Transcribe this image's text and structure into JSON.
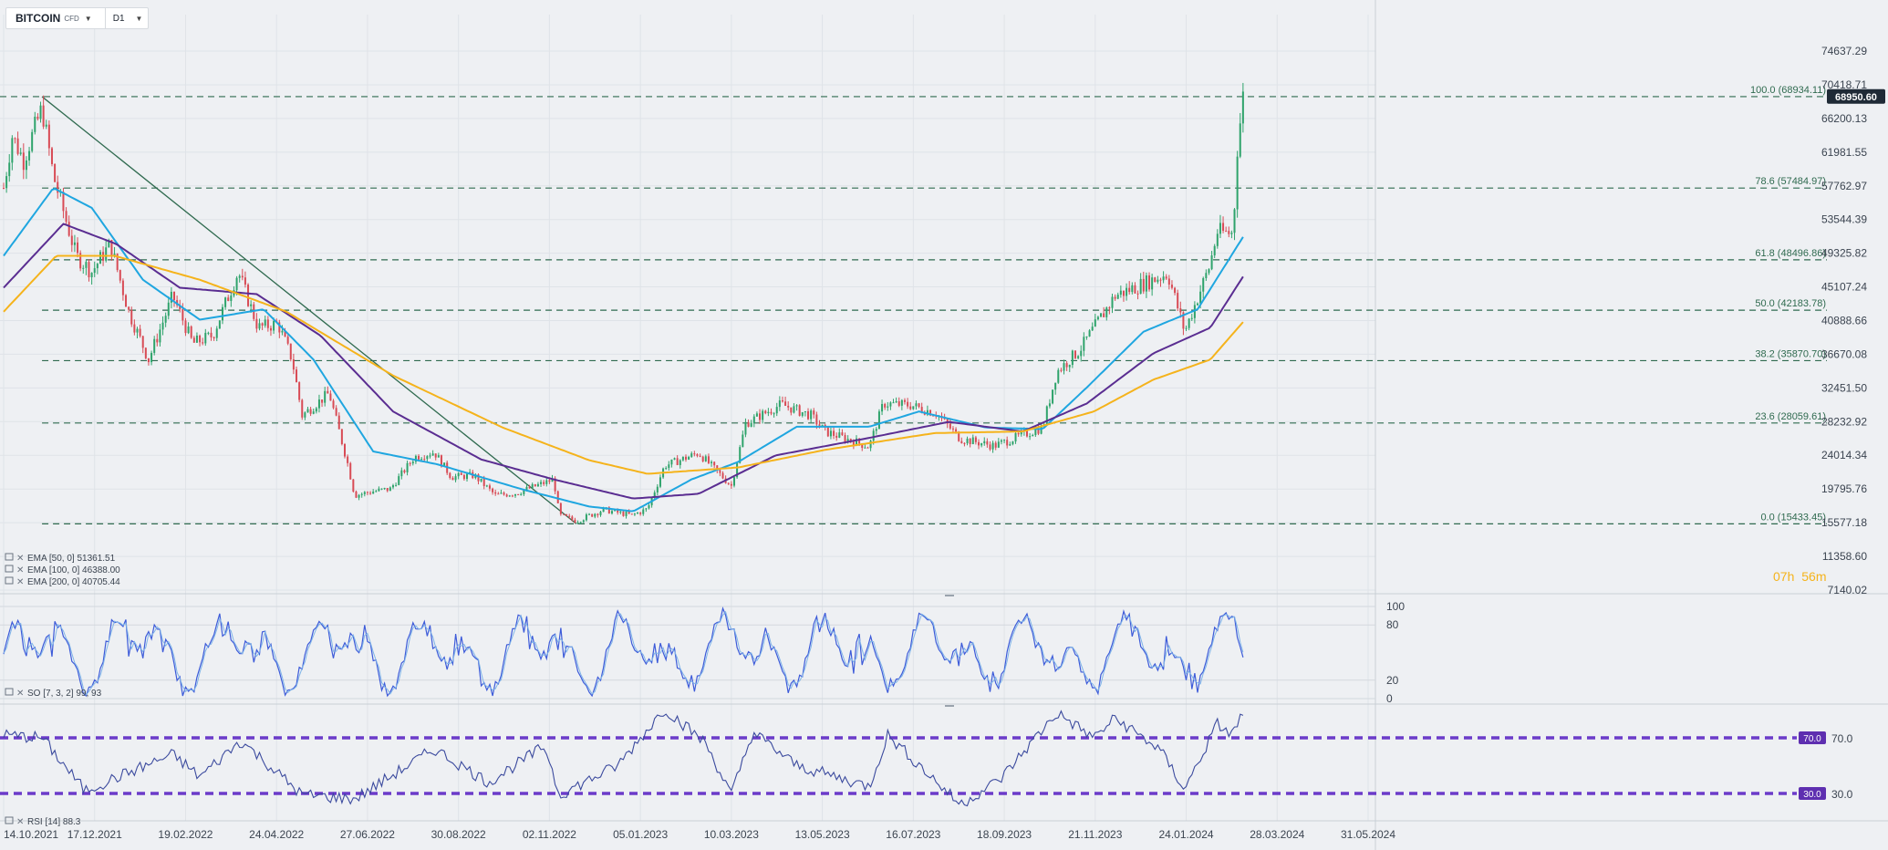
{
  "header": {
    "symbol": "BITCOIN",
    "symbol_sub": "CFD",
    "timeframe": "D1"
  },
  "countdown": {
    "h": "07h",
    "m": "56m"
  },
  "chart_data": {
    "type": "candlestick",
    "price_axis": {
      "ticks": [
        "74637.29",
        "70418.71",
        "66200.13",
        "61981.55",
        "57762.97",
        "53544.39",
        "49325.82",
        "45107.24",
        "40888.66",
        "36670.08",
        "32451.50",
        "28232.92",
        "24014.34",
        "19795.76",
        "15577.18",
        "11358.60",
        "7140.02"
      ],
      "current_price": "68950.60",
      "current_price_value": 68950.6
    },
    "date_axis": [
      "14.10.2021",
      "17.12.2021",
      "19.02.2022",
      "24.04.2022",
      "27.06.2022",
      "30.08.2022",
      "02.11.2022",
      "05.01.2023",
      "10.03.2023",
      "13.05.2023",
      "16.07.2023",
      "18.09.2023",
      "21.11.2023",
      "24.01.2024",
      "28.03.2024",
      "31.05.2024"
    ],
    "fibonacci": [
      {
        "level": 100,
        "value": 68934.11,
        "label": "100.0 (68934.11)"
      },
      {
        "level": 78.6,
        "value": 57484.97,
        "label": "78.6 (57484.97)"
      },
      {
        "level": 61.8,
        "value": 48496.86,
        "label": "61.8 (48496.86)"
      },
      {
        "level": 50,
        "value": 42183.78,
        "label": "50.0 (42183.78)"
      },
      {
        "level": 38.2,
        "value": 35870.7,
        "label": "38.2 (35870.70)"
      },
      {
        "level": 23.6,
        "value": 28059.61,
        "label": "23.6 (28059.61)"
      },
      {
        "level": 0,
        "value": 15433.45,
        "label": "0.0 (15433.45)"
      }
    ],
    "trendline": {
      "from": {
        "date": "2021-11-10",
        "price": 68934
      },
      "to": {
        "date": "2022-11-21",
        "price": 15433
      }
    },
    "price_path": [
      {
        "date": "2021-10-14",
        "price": 57500
      },
      {
        "date": "2021-10-20",
        "price": 64000
      },
      {
        "date": "2021-10-28",
        "price": 61000
      },
      {
        "date": "2021-11-10",
        "price": 67500
      },
      {
        "date": "2021-11-18",
        "price": 59000
      },
      {
        "date": "2021-12-04",
        "price": 49000
      },
      {
        "date": "2021-12-15",
        "price": 47000
      },
      {
        "date": "2021-12-28",
        "price": 50500
      },
      {
        "date": "2022-01-10",
        "price": 42000
      },
      {
        "date": "2022-01-24",
        "price": 36000
      },
      {
        "date": "2022-02-10",
        "price": 44000
      },
      {
        "date": "2022-02-24",
        "price": 38000
      },
      {
        "date": "2022-03-10",
        "price": 39000
      },
      {
        "date": "2022-03-28",
        "price": 47000
      },
      {
        "date": "2022-04-11",
        "price": 40000
      },
      {
        "date": "2022-04-25",
        "price": 40500
      },
      {
        "date": "2022-05-05",
        "price": 36000
      },
      {
        "date": "2022-05-12",
        "price": 29000
      },
      {
        "date": "2022-05-31",
        "price": 31800
      },
      {
        "date": "2022-06-13",
        "price": 23000
      },
      {
        "date": "2022-06-18",
        "price": 19000
      },
      {
        "date": "2022-07-01",
        "price": 19500
      },
      {
        "date": "2022-07-13",
        "price": 19800
      },
      {
        "date": "2022-07-30",
        "price": 23800
      },
      {
        "date": "2022-08-13",
        "price": 24400
      },
      {
        "date": "2022-08-25",
        "price": 21300
      },
      {
        "date": "2022-09-10",
        "price": 21500
      },
      {
        "date": "2022-09-25",
        "price": 19000
      },
      {
        "date": "2022-10-10",
        "price": 19300
      },
      {
        "date": "2022-11-05",
        "price": 21000
      },
      {
        "date": "2022-11-09",
        "price": 16500
      },
      {
        "date": "2022-11-21",
        "price": 15800
      },
      {
        "date": "2022-12-10",
        "price": 17200
      },
      {
        "date": "2022-12-30",
        "price": 16500
      },
      {
        "date": "2023-01-10",
        "price": 17300
      },
      {
        "date": "2023-01-22",
        "price": 22700
      },
      {
        "date": "2023-02-15",
        "price": 24300
      },
      {
        "date": "2023-03-10",
        "price": 20200
      },
      {
        "date": "2023-03-20",
        "price": 28000
      },
      {
        "date": "2023-04-14",
        "price": 30400
      },
      {
        "date": "2023-05-05",
        "price": 29000
      },
      {
        "date": "2023-05-15",
        "price": 27000
      },
      {
        "date": "2023-06-15",
        "price": 25100
      },
      {
        "date": "2023-06-25",
        "price": 30500
      },
      {
        "date": "2023-07-14",
        "price": 30300
      },
      {
        "date": "2023-08-01",
        "price": 29300
      },
      {
        "date": "2023-08-18",
        "price": 26100
      },
      {
        "date": "2023-09-11",
        "price": 25200
      },
      {
        "date": "2023-10-15",
        "price": 27500
      },
      {
        "date": "2023-10-25",
        "price": 34500
      },
      {
        "date": "2023-11-10",
        "price": 37200
      },
      {
        "date": "2023-12-05",
        "price": 44000
      },
      {
        "date": "2024-01-11",
        "price": 46800
      },
      {
        "date": "2024-01-23",
        "price": 39500
      },
      {
        "date": "2024-02-09",
        "price": 47500
      },
      {
        "date": "2024-02-15",
        "price": 52000
      },
      {
        "date": "2024-02-26",
        "price": 51800
      },
      {
        "date": "2024-02-29",
        "price": 62500
      },
      {
        "date": "2024-03-04",
        "price": 68950
      }
    ],
    "indicators": [
      {
        "name": "EMA [50, 0]",
        "value": "51361.51",
        "color": "#1fa6e0",
        "path": [
          {
            "date": "2021-10-14",
            "price": 49000
          },
          {
            "date": "2021-11-18",
            "price": 57500
          },
          {
            "date": "2021-12-15",
            "price": 55000
          },
          {
            "date": "2022-01-20",
            "price": 46000
          },
          {
            "date": "2022-03-01",
            "price": 41000
          },
          {
            "date": "2022-04-15",
            "price": 42300
          },
          {
            "date": "2022-05-20",
            "price": 36000
          },
          {
            "date": "2022-07-01",
            "price": 24500
          },
          {
            "date": "2022-08-15",
            "price": 22900
          },
          {
            "date": "2022-10-15",
            "price": 19700
          },
          {
            "date": "2022-11-30",
            "price": 17600
          },
          {
            "date": "2022-12-31",
            "price": 17000
          },
          {
            "date": "2023-02-10",
            "price": 21000
          },
          {
            "date": "2023-03-15",
            "price": 23200
          },
          {
            "date": "2023-04-25",
            "price": 27600
          },
          {
            "date": "2023-06-15",
            "price": 27600
          },
          {
            "date": "2023-07-20",
            "price": 29500
          },
          {
            "date": "2023-09-05",
            "price": 27500
          },
          {
            "date": "2023-10-15",
            "price": 27300
          },
          {
            "date": "2023-11-15",
            "price": 32500
          },
          {
            "date": "2023-12-25",
            "price": 39500
          },
          {
            "date": "2024-02-01",
            "price": 42300
          },
          {
            "date": "2024-03-04",
            "price": 51361
          }
        ]
      },
      {
        "name": "EMA [100, 0]",
        "value": "46388.00",
        "color": "#5a2d91",
        "path": [
          {
            "date": "2021-10-14",
            "price": 45000
          },
          {
            "date": "2021-11-25",
            "price": 53000
          },
          {
            "date": "2022-01-01",
            "price": 50500
          },
          {
            "date": "2022-02-15",
            "price": 45000
          },
          {
            "date": "2022-04-10",
            "price": 44200
          },
          {
            "date": "2022-05-25",
            "price": 39000
          },
          {
            "date": "2022-07-15",
            "price": 29500
          },
          {
            "date": "2022-09-15",
            "price": 23500
          },
          {
            "date": "2022-11-05",
            "price": 21000
          },
          {
            "date": "2022-12-31",
            "price": 18600
          },
          {
            "date": "2023-02-15",
            "price": 19200
          },
          {
            "date": "2023-04-10",
            "price": 24000
          },
          {
            "date": "2023-06-15",
            "price": 26200
          },
          {
            "date": "2023-08-10",
            "price": 28200
          },
          {
            "date": "2023-10-01",
            "price": 27000
          },
          {
            "date": "2023-11-15",
            "price": 30500
          },
          {
            "date": "2024-01-01",
            "price": 36800
          },
          {
            "date": "2024-02-10",
            "price": 40000
          },
          {
            "date": "2024-03-04",
            "price": 46388
          }
        ]
      },
      {
        "name": "EMA [200, 0]",
        "value": "40705.44",
        "color": "#f5b31b",
        "path": [
          {
            "date": "2021-10-14",
            "price": 42000
          },
          {
            "date": "2021-11-20",
            "price": 49000
          },
          {
            "date": "2021-12-31",
            "price": 49000
          },
          {
            "date": "2022-03-01",
            "price": 46000
          },
          {
            "date": "2022-05-01",
            "price": 42000
          },
          {
            "date": "2022-07-15",
            "price": 34000
          },
          {
            "date": "2022-09-30",
            "price": 27500
          },
          {
            "date": "2022-11-30",
            "price": 23400
          },
          {
            "date": "2023-01-10",
            "price": 21700
          },
          {
            "date": "2023-03-15",
            "price": 22500
          },
          {
            "date": "2023-05-15",
            "price": 24700
          },
          {
            "date": "2023-07-31",
            "price": 26800
          },
          {
            "date": "2023-10-01",
            "price": 27000
          },
          {
            "date": "2023-11-20",
            "price": 29500
          },
          {
            "date": "2024-01-01",
            "price": 33500
          },
          {
            "date": "2024-02-10",
            "price": 36000
          },
          {
            "date": "2024-03-04",
            "price": 40705
          }
        ]
      }
    ],
    "stochastic": {
      "label": "SO [7, 3, 2] 99, 93",
      "levels": [
        {
          "label": "100",
          "value": 100
        },
        {
          "label": "80",
          "value": 80
        },
        {
          "label": "20",
          "value": 20
        },
        {
          "label": "0",
          "value": 0
        }
      ]
    },
    "rsi": {
      "label": "RSI [14] 88.3",
      "upper_level": {
        "label": "70.0",
        "value": 70
      },
      "lower_level": {
        "label": "30.0",
        "value": 30
      },
      "path": [
        {
          "date": "2021-10-14",
          "price": 72
        },
        {
          "date": "2021-11-10",
          "price": 70
        },
        {
          "date": "2021-12-10",
          "price": 32
        },
        {
          "date": "2022-02-10",
          "price": 58
        },
        {
          "date": "2022-03-01",
          "price": 42
        },
        {
          "date": "2022-03-30",
          "price": 68
        },
        {
          "date": "2022-05-12",
          "price": 29
        },
        {
          "date": "2022-06-18",
          "price": 26
        },
        {
          "date": "2022-08-13",
          "price": 62
        },
        {
          "date": "2022-09-20",
          "price": 38
        },
        {
          "date": "2022-10-30",
          "price": 64
        },
        {
          "date": "2022-11-09",
          "price": 29
        },
        {
          "date": "2022-12-20",
          "price": 50
        },
        {
          "date": "2023-01-22",
          "price": 91
        },
        {
          "date": "2023-02-20",
          "price": 66
        },
        {
          "date": "2023-03-10",
          "price": 29
        },
        {
          "date": "2023-03-25",
          "price": 74
        },
        {
          "date": "2023-04-25",
          "price": 50
        },
        {
          "date": "2023-06-15",
          "price": 35
        },
        {
          "date": "2023-06-28",
          "price": 72
        },
        {
          "date": "2023-08-18",
          "price": 22
        },
        {
          "date": "2023-09-15",
          "price": 40
        },
        {
          "date": "2023-10-25",
          "price": 88
        },
        {
          "date": "2023-11-20",
          "price": 70
        },
        {
          "date": "2023-12-05",
          "price": 84
        },
        {
          "date": "2024-01-05",
          "price": 62
        },
        {
          "date": "2024-01-23",
          "price": 33
        },
        {
          "date": "2024-02-15",
          "price": 80
        },
        {
          "date": "2024-02-25",
          "price": 72
        },
        {
          "date": "2024-03-04",
          "price": 88
        }
      ]
    }
  }
}
